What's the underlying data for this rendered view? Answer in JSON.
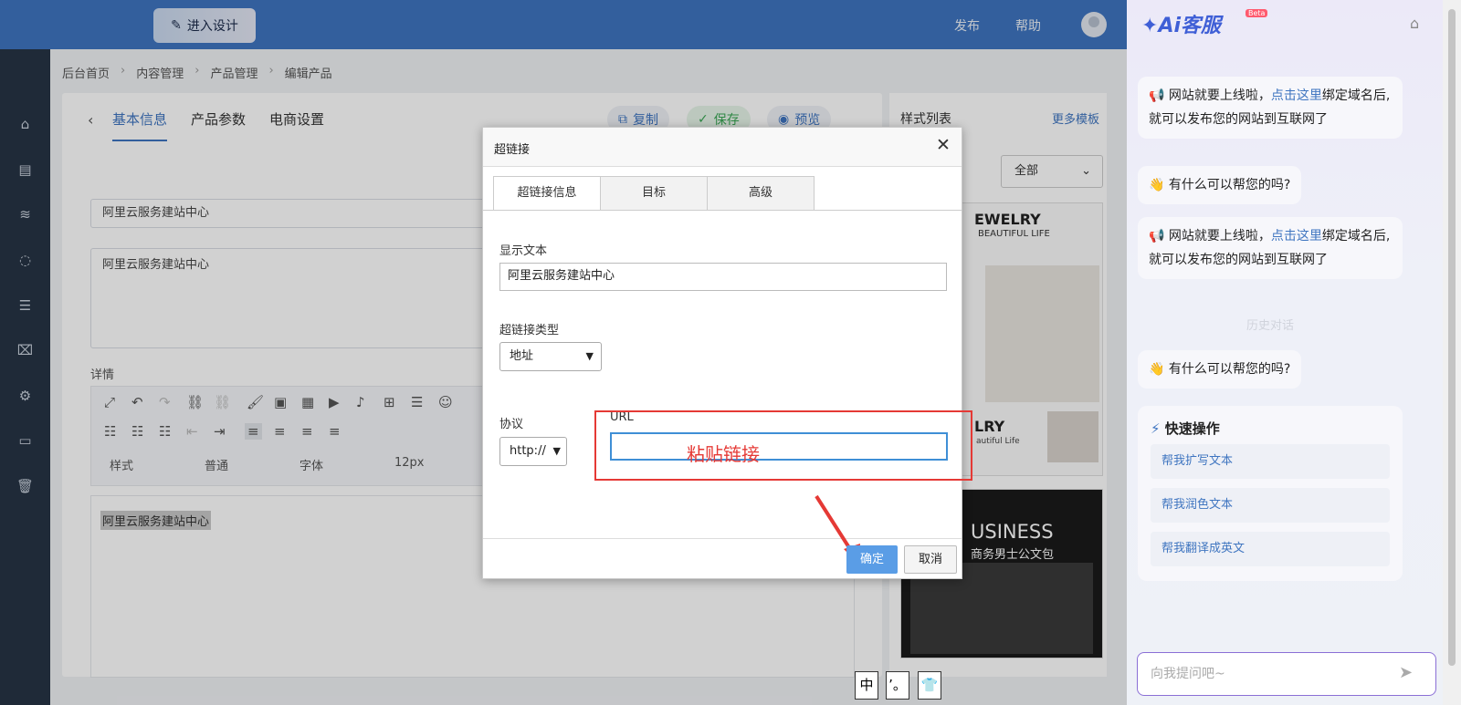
{
  "header": {
    "design_button": "进入设计",
    "publish": "发布",
    "help": "帮助"
  },
  "sidebar": {
    "icons": [
      "home-icon",
      "document-icon",
      "layers-icon",
      "chat-icon",
      "list-icon",
      "shop-icon",
      "gear-icon",
      "terminal-icon",
      "trash-icon"
    ]
  },
  "breadcrumb": [
    "后台首页",
    "内容管理",
    "产品管理",
    "编辑产品"
  ],
  "editor": {
    "tabs": [
      "基本信息",
      "产品参数",
      "电商设置"
    ],
    "actions": {
      "copy": "复制",
      "save": "保存",
      "preview": "预览"
    },
    "field1": "阿里云服务建站中心",
    "field2": "阿里云服务建站中心",
    "details_label": "详情",
    "font_style": "样式",
    "font_format": "普通",
    "font_family": "字体",
    "font_size": "12px",
    "body_text": "阿里云服务建站中心"
  },
  "style_panel": {
    "title": "样式列表",
    "more": "更多模板",
    "filter": "全部",
    "thumb1_title": "EWELRY",
    "thumb1_sub": "BEAUTIFUL LIFE",
    "thumb1_small": "LRY",
    "thumb1_small_sub": "autiful Life",
    "thumb2_title": "USINESS",
    "thumb2_sub": "商务男士公文包"
  },
  "dialog": {
    "title": "超链接",
    "tabs": [
      "超链接信息",
      "目标",
      "高级"
    ],
    "display_text_label": "显示文本",
    "display_text_value": "阿里云服务建站中心",
    "link_type_label": "超链接类型",
    "link_type_value": "地址",
    "protocol_label": "协议",
    "protocol_value": "http://",
    "url_label": "URL",
    "url_annotation": "粘贴链接",
    "ok": "确定",
    "cancel": "取消"
  },
  "chat": {
    "brand": "Ai客服",
    "beta": "Beta",
    "msg1_pre": "网站就要上线啦，",
    "msg1_link": "点击这里",
    "msg1_post": "绑定域名后,就可以发布您的网站到互联网了",
    "msg2": "有什么可以帮您的吗?",
    "msg3_pre": "网站就要上线啦，",
    "msg3_link": "点击这里",
    "msg3_post": "绑定域名后,就可以发布您的网站到互联网了",
    "history": "历史对话",
    "msg4": "有什么可以帮您的吗?",
    "quick_title": "快速操作",
    "quick_items": [
      "帮我扩写文本",
      "帮我润色文本",
      "帮我翻译成英文"
    ],
    "input_placeholder": "向我提问吧~"
  },
  "ime": [
    "中",
    "’。",
    "👕"
  ],
  "colors": {
    "accent": "#3f75c0",
    "annotation_red": "#e53935",
    "chat_border": "#8b6fd6"
  }
}
